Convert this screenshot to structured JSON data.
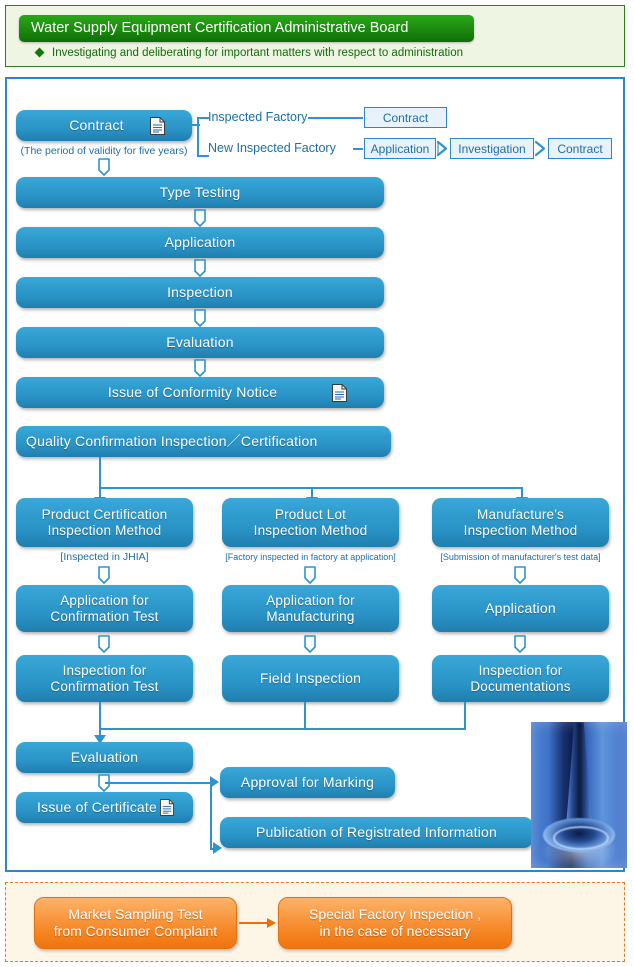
{
  "header": {
    "title": "Water Supply Equipment Certification Administrative Board",
    "bullet_icon": "diamond-bullet-icon",
    "bullet_text": "Investigating and deliberating for important matters with respect to administration",
    "accent_color": "#1d8f10",
    "panel_bg": "#eef5e3"
  },
  "flow": {
    "accent_color": "#2f93cd",
    "box_gradient_top": "#3aa8d8",
    "box_gradient_bottom": "#1f7fae",
    "contract": {
      "label": "Contract",
      "icon": "document-icon",
      "caption": "(The period of validity for five years)"
    },
    "branch": {
      "inspected_factory_label": "Inspected Factory",
      "inspected_factory_result": "Contract",
      "new_factory_label": "New Inspected Factory",
      "new_factory_steps": [
        "Application",
        "Investigation",
        "Contract"
      ],
      "chevron_icon": "chevron-right-icon"
    },
    "main_steps": [
      {
        "label": "Type Testing",
        "icon": ""
      },
      {
        "label": "Application",
        "icon": ""
      },
      {
        "label": "Inspection",
        "icon": ""
      },
      {
        "label": "Evaluation",
        "icon": ""
      },
      {
        "label": "Issue of Conformity Notice",
        "icon": "document-icon"
      }
    ],
    "quality_box": {
      "label": "Quality Confirmation Inspection／Certification"
    },
    "methods": [
      {
        "title_line1": "Product Certification",
        "title_line2": "Inspection Method",
        "note": "[Inspected in JHIA]",
        "step1_line1": "Application for",
        "step1_line2": "Confirmation Test",
        "step2_line1": "Inspection for",
        "step2_line2": "Confirmation Test"
      },
      {
        "title_line1": "Product Lot",
        "title_line2": "Inspection Method",
        "note": "[Factory inspected in factory at application]",
        "step1_line1": "Application for",
        "step1_line2": "Manufacturing",
        "step2_line1": "Field Inspection",
        "step2_line2": ""
      },
      {
        "title_line1": "Manufacture's",
        "title_line2": "Inspection Method",
        "note": "[Submission of manufacturer's test data]",
        "step1_line1": "Application",
        "step1_line2": "",
        "step2_line1": "Inspection for",
        "step2_line2": "Documentations"
      }
    ],
    "evaluation": {
      "label": "Evaluation"
    },
    "issue_certificate": {
      "label": "Issue of Certificate",
      "icon": "document-icon"
    },
    "outputs": [
      {
        "label": "Approval for Marking"
      },
      {
        "label": "Publication of Registrated Information"
      }
    ],
    "photo": {
      "name": "water-stream-photo"
    }
  },
  "bottom": {
    "panel_bg": "#fdf6e6",
    "accent_color": "#ef7510",
    "left_box_line1": "Market Sampling Test",
    "left_box_line2": "from Consumer Complaint",
    "right_box_line1": "Special Factory Inspection ,",
    "right_box_line2": "in the case of necessary",
    "arrow_icon": "arrow-right-icon"
  }
}
